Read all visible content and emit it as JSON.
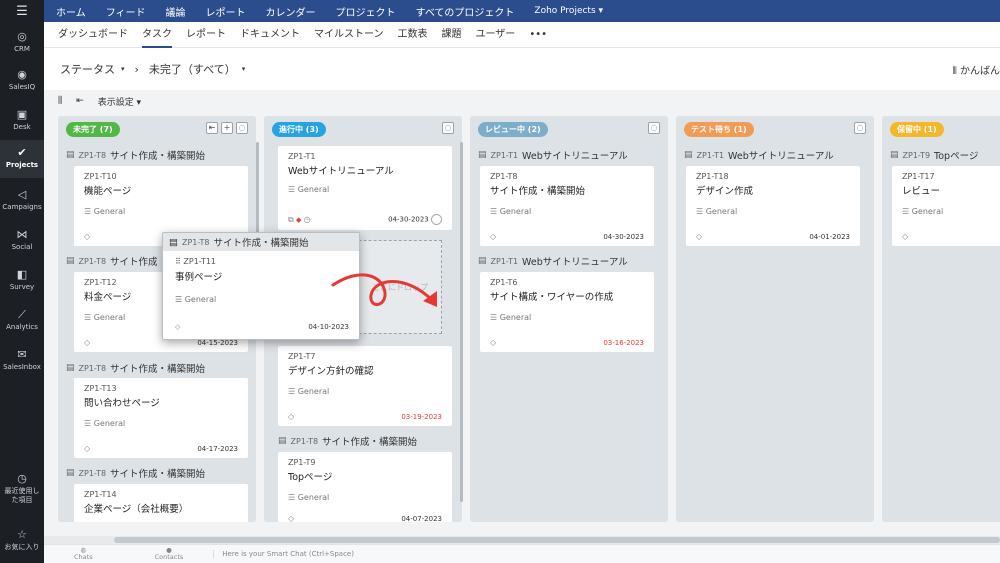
{
  "rail": {
    "top_icon": "⋮",
    "items": [
      {
        "label": "CRM",
        "icon": "crm-icon"
      },
      {
        "label": "SalesIQ",
        "icon": "salesiq-icon"
      },
      {
        "label": "Desk",
        "icon": "desk-icon"
      },
      {
        "label": "Projects",
        "icon": "projects-icon"
      },
      {
        "label": "Campaigns",
        "icon": "campaigns-icon"
      },
      {
        "label": "Social",
        "icon": "social-icon"
      },
      {
        "label": "Survey",
        "icon": "survey-icon"
      },
      {
        "label": "Analytics",
        "icon": "analytics-icon"
      },
      {
        "label": "SalesInbox",
        "icon": "salesinbox-icon"
      }
    ],
    "recent_label": "最近使用した項目",
    "favorites_label": "お気に入り"
  },
  "topnav": {
    "items": [
      "ホーム",
      "フィード",
      "議論",
      "レポート",
      "カレンダー",
      "プロジェクト",
      "すべてのプロジェクト"
    ],
    "portal": "Zoho Projects ▾"
  },
  "tabs": {
    "items": [
      "ダッシュボード",
      "タスク",
      "レポート",
      "ドキュメント",
      "マイルストーン",
      "工数表",
      "課題",
      "ユーザー",
      "•••"
    ],
    "active": "タスク"
  },
  "filter": {
    "status": "ステータス",
    "separator": "›",
    "view": "未完了（すべて）",
    "right": "かんばん"
  },
  "toolbar": {
    "display_settings": "表示設定 ▾"
  },
  "colors": {
    "todo": "#52b748",
    "inprogress": "#27a3e0",
    "review": "#7dadc9",
    "test": "#f29b54",
    "hold": "#f5b62a",
    "nav": "#2b4d8d"
  },
  "columns": [
    {
      "label": "未完了 (7)",
      "groups": [
        {
          "id": "ZP1-T8",
          "title": "サイト作成・構築開始"
        },
        {
          "id": "ZP1-T8",
          "title": "サイト作成"
        },
        {
          "id": "ZP1-T8",
          "title": "サイト作成・構築開始"
        },
        {
          "id": "ZP1-T8",
          "title": "サイト作成・構築開始"
        }
      ],
      "cards": [
        {
          "id": "ZP1-T10",
          "title": "機能ページ",
          "tag": "General",
          "date": ""
        },
        {
          "id": "ZP1-T12",
          "title": "料金ページ",
          "tag": "General",
          "date": "04-15-2023"
        },
        {
          "id": "ZP1-T13",
          "title": "問い合わせページ",
          "tag": "General",
          "date": "04-17-2023"
        },
        {
          "id": "ZP1-T14",
          "title": "企業ページ（会社概要）",
          "tag": "",
          "date": ""
        }
      ]
    },
    {
      "label": "進行中 (3)",
      "groups": [
        {
          "id": "ZP1-T8",
          "title": "サイト作成・構築開始"
        }
      ],
      "cards": [
        {
          "id": "ZP1-T1",
          "title": "Webサイトリニューアル",
          "tag": "General",
          "date": "04-30-2023"
        },
        {
          "id": "ZP1-T7",
          "title": "デザイン方針の確認",
          "tag": "General",
          "date": "03-19-2023"
        },
        {
          "id": "ZP1-T9",
          "title": "Topページ",
          "tag": "General",
          "date": "04-07-2023"
        }
      ],
      "drop_hint": "ここにドロップ"
    },
    {
      "label": "レビュー中 (2)",
      "groups": [
        {
          "id": "ZP1-T1",
          "title": "Webサイトリニューアル"
        },
        {
          "id": "ZP1-T1",
          "title": "Webサイトリニューアル"
        }
      ],
      "cards": [
        {
          "id": "ZP1-T8",
          "title": "サイト作成・構築開始",
          "tag": "General",
          "date": "04-30-2023"
        },
        {
          "id": "ZP1-T6",
          "title": "サイト構成・ワイヤーの作成",
          "tag": "General",
          "date": "03-16-2023"
        }
      ]
    },
    {
      "label": "テスト待ち (1)",
      "groups": [
        {
          "id": "ZP1-T1",
          "title": "Webサイトリニューアル"
        }
      ],
      "cards": [
        {
          "id": "ZP1-T18",
          "title": "デザイン作成",
          "tag": "General",
          "date": "04-01-2023"
        }
      ]
    },
    {
      "label": "保留中 (1)",
      "groups": [
        {
          "id": "ZP1-T9",
          "title": "Topページ"
        }
      ],
      "cards": [
        {
          "id": "ZP1-T17",
          "title": "レビュー",
          "tag": "General",
          "date": ""
        }
      ]
    }
  ],
  "dragged": {
    "group_id": "ZP1-T8",
    "group_title": "サイト作成・構築開始",
    "id": "ZP1-T11",
    "title": "事例ページ",
    "tag": "General",
    "date": "04-10-2023"
  },
  "bottombar": {
    "chats": "Chats",
    "contacts": "Contacts",
    "smart_chat": "Here is your Smart Chat (Ctrl+Space)"
  }
}
